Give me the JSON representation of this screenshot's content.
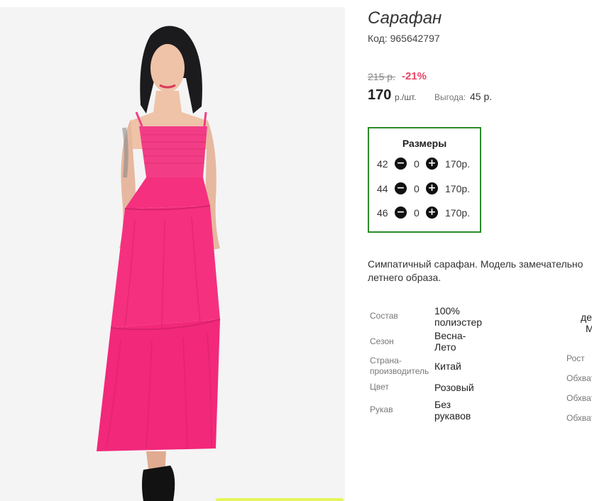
{
  "product": {
    "title": "Сарафан",
    "code": "Код: 965642797",
    "old_price": "215 р.",
    "discount": "-21%",
    "price": "170",
    "unit": "р./шт.",
    "savings_label": "Выгода:",
    "savings_value": "45 р."
  },
  "sizes": {
    "title": "Размеры",
    "rows": [
      {
        "size": "42",
        "qty": "0",
        "price": "170р."
      },
      {
        "size": "44",
        "qty": "0",
        "price": "170р."
      },
      {
        "size": "46",
        "qty": "0",
        "price": "170р."
      }
    ],
    "minus_icon": "−",
    "plus_icon": "+"
  },
  "description": {
    "line1": "Симпатичный сарафан. Модель замечательно",
    "line2": "летнего образа."
  },
  "specs": [
    {
      "label": "Состав",
      "value": "100% полиэстер"
    },
    {
      "label": "Сезон",
      "value": "Весна-Лето"
    },
    {
      "label": "Страна-производитель",
      "value": "Китай"
    },
    {
      "label": "Цвет",
      "value": "Розовый"
    },
    {
      "label": "Рукав",
      "value": "Без рукавов"
    }
  ],
  "specs_right": {
    "head_line1": "де",
    "head_line2": "М",
    "labels": [
      "Рост",
      "Обхват",
      "Обхват",
      "Обхват"
    ]
  },
  "colors": {
    "accent_discount": "#e84565",
    "sizes_border": "#2a8a2a",
    "dress": "#f5307f"
  }
}
